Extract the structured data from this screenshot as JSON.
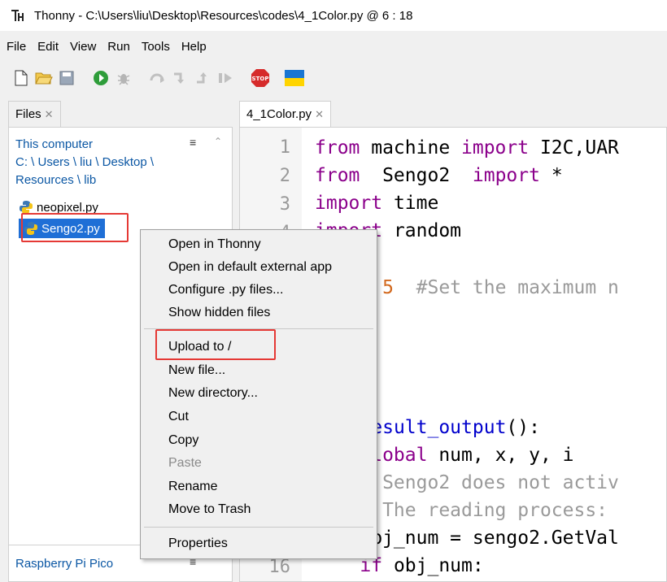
{
  "window": {
    "title": "Thonny  -  C:\\Users\\liu\\Desktop\\Resources\\codes\\4_1Color.py  @  6 : 18"
  },
  "menu": [
    "File",
    "Edit",
    "View",
    "Run",
    "Tools",
    "Help"
  ],
  "files_panel": {
    "tab_label": "Files",
    "computer_label": "This computer",
    "path_line1": "C: \\ Users \\ liu \\ Desktop \\",
    "path_line2": "Resources \\ lib",
    "files": [
      "neopixel.py",
      "Sengo2.py"
    ],
    "pico_label": "Raspberry Pi Pico"
  },
  "editor": {
    "tab_label": "4_1Color.py",
    "line_numbers": [
      "1",
      "2",
      "3",
      "4",
      "16"
    ]
  },
  "context_menu": {
    "items": [
      "Open in Thonny",
      "Open in default external app",
      "Configure .py files...",
      "Show hidden files",
      "Upload to /",
      "New file...",
      "New directory...",
      "Cut",
      "Copy",
      "Paste",
      "Rename",
      "Move to Trash",
      "Properties"
    ]
  },
  "colors": {
    "selection": "#1f6fd6",
    "highlight_box": "#e53935",
    "keyword": "#8b008b"
  },
  "icons": [
    "thonny-logo-icon",
    "new-file-icon",
    "open-folder-icon",
    "save-icon",
    "run-icon",
    "debug-icon",
    "step-over-icon",
    "step-into-icon",
    "step-out-icon",
    "resume-icon",
    "stop-icon",
    "ukraine-flag-icon",
    "hamburger-icon",
    "python-file-icon"
  ]
}
